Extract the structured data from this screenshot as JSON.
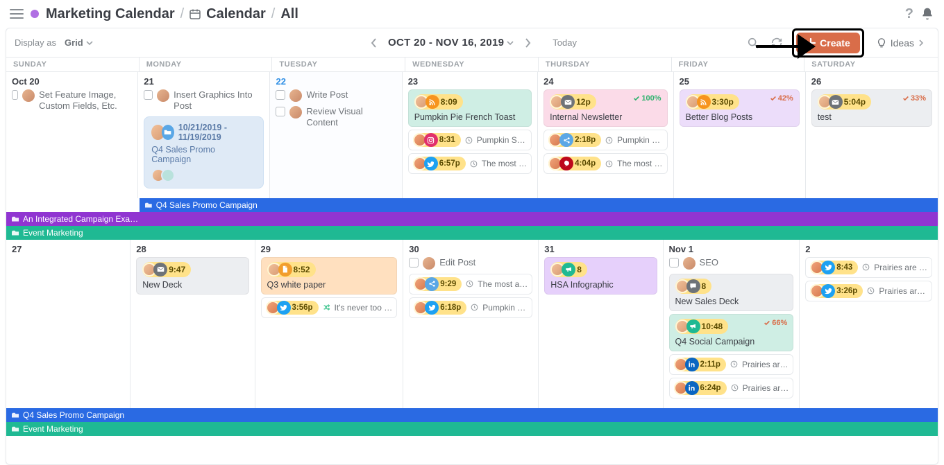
{
  "breadcrumbs": {
    "project": "Marketing Calendar",
    "section": "Calendar",
    "filter": "All"
  },
  "toolbar": {
    "display_as_label": "Display as",
    "display_as_value": "Grid",
    "date_range": "OCT 20 - NOV 16, 2019",
    "today_label": "Today",
    "create_label": "Create",
    "ideas_label": "Ideas"
  },
  "days_of_week": [
    "SUNDAY",
    "MONDAY",
    "TUESDAY",
    "WEDNESDAY",
    "THURSDAY",
    "FRIDAY",
    "SATURDAY"
  ],
  "weeks": [
    {
      "dates": [
        "Oct 20",
        "21",
        "22",
        "23",
        "24",
        "25",
        "26"
      ],
      "today_index": 2,
      "cells": [
        {
          "tasks": [
            {
              "text": "Set Feature Image, Custom Fields, Etc."
            }
          ]
        },
        {
          "tasks": [
            {
              "text": "Insert Graphics Into Post"
            }
          ],
          "range_card": {
            "dates": "10/21/2019 - 11/19/2019",
            "title": "Q4 Sales Promo Campaign"
          }
        },
        {
          "tasks": [
            {
              "text": "Write Post"
            },
            {
              "text": "Review Visual Content"
            }
          ]
        },
        {
          "events": [
            {
              "bg": "mint",
              "icon": "rss",
              "time": "8:09",
              "title": "Pumpkin Pie French Toast"
            }
          ],
          "minis": [
            {
              "icon": "ig",
              "time": "8:31",
              "text": "Pumpkin S…"
            },
            {
              "icon": "tw",
              "time": "6:57p",
              "text": "The most …"
            }
          ]
        },
        {
          "events": [
            {
              "bg": "pink",
              "icon": "mail",
              "time": "12p",
              "title": "Internal Newsletter",
              "status": "100%",
              "statusType": "ok"
            }
          ],
          "minis": [
            {
              "icon": "share",
              "time": "2:18p",
              "text": "Pumpkin …"
            },
            {
              "icon": "pin",
              "time": "4:04p",
              "text": "The most …"
            }
          ]
        },
        {
          "events": [
            {
              "bg": "lav",
              "icon": "rss",
              "time": "3:30p",
              "title": "Better Blog Posts",
              "status": "42%",
              "statusType": "warn"
            }
          ]
        },
        {
          "events": [
            {
              "bg": "gray",
              "icon": "mail",
              "time": "5:04p",
              "title": "test",
              "status": "33%",
              "statusType": "warn"
            }
          ]
        }
      ],
      "bars": [
        {
          "color": "blue",
          "label": "Q4 Sales Promo Campaign",
          "start": 1
        },
        {
          "color": "purple",
          "label": "An Integrated Campaign Exa…",
          "start": 0
        },
        {
          "color": "teal",
          "label": "Event Marketing",
          "start": 0
        }
      ]
    },
    {
      "dates": [
        "27",
        "28",
        "29",
        "30",
        "31",
        "Nov 1",
        "2"
      ],
      "cells": [
        {},
        {
          "events": [
            {
              "bg": "gray",
              "icon": "mail",
              "time": "9:47",
              "title": "New Deck"
            }
          ]
        },
        {
          "events": [
            {
              "bg": "peach",
              "icon": "doc",
              "time": "8:52",
              "title": "Q3 white paper"
            }
          ],
          "minis": [
            {
              "icon": "tw",
              "time": "3:56p",
              "text": "It's never too …",
              "shuffle": true
            }
          ]
        },
        {
          "tasks": [
            {
              "text": "Edit Post"
            }
          ],
          "minis": [
            {
              "icon": "share",
              "time": "9:29",
              "text": "The most a…"
            },
            {
              "icon": "tw",
              "time": "6:18p",
              "text": "Pumpkin …"
            }
          ]
        },
        {
          "events": [
            {
              "bg": "lavlight",
              "icon": "meg",
              "time": "8",
              "title": "HSA Infographic"
            }
          ]
        },
        {
          "tasks": [
            {
              "text": "SEO"
            }
          ],
          "events": [
            {
              "bg": "gray",
              "icon": "chat",
              "time": "8",
              "title": "New Sales Deck"
            },
            {
              "bg": "mint",
              "icon": "meg",
              "time": "10:48",
              "title": "Q4 Social Campaign",
              "status": "66%",
              "statusType": "warn"
            }
          ],
          "minis": [
            {
              "icon": "li",
              "time": "2:11p",
              "text": "Prairies ar…"
            },
            {
              "icon": "li",
              "time": "6:24p",
              "text": "Prairies ar…"
            }
          ]
        },
        {
          "minis": [
            {
              "icon": "tw",
              "time": "8:43",
              "text": "Prairies are …"
            },
            {
              "icon": "tw",
              "time": "3:26p",
              "text": "Prairies ar…"
            }
          ]
        }
      ],
      "bars": [
        {
          "color": "blue",
          "label": "Q4 Sales Promo Campaign",
          "start": 0
        },
        {
          "color": "teal",
          "label": "Event Marketing",
          "start": 0
        }
      ]
    }
  ],
  "colors": {
    "accent": "#d96d49",
    "blue": "#2a6ae3",
    "purple": "#9035d1",
    "teal": "#1fb993"
  }
}
